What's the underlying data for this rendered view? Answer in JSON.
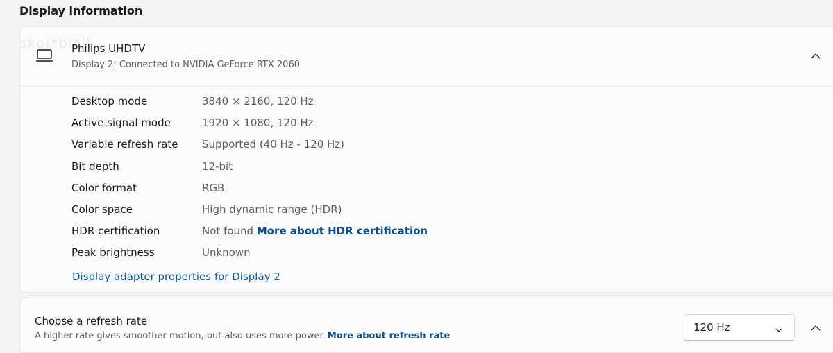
{
  "section": {
    "title": "Display information"
  },
  "display_card": {
    "name": "Philips UHDTV",
    "subtitle": "Display 2: Connected to NVIDIA GeForce RTX 2060",
    "rows": [
      {
        "label": "Desktop mode",
        "value": "3840 × 2160, 120 Hz"
      },
      {
        "label": "Active signal mode",
        "value": "1920 × 1080, 120 Hz"
      },
      {
        "label": "Variable refresh rate",
        "value": "Supported (40 Hz - 120 Hz)"
      },
      {
        "label": "Bit depth",
        "value": "12-bit"
      },
      {
        "label": "Color format",
        "value": "RGB"
      },
      {
        "label": "Color space",
        "value": "High dynamic range (HDR)"
      },
      {
        "label": "HDR certification",
        "value": "Not found",
        "link": "More about HDR certification"
      },
      {
        "label": "Peak brightness",
        "value": "Unknown"
      }
    ],
    "adapter_link": "Display adapter properties for Display 2"
  },
  "refresh_card": {
    "title": "Choose a refresh rate",
    "description": "A higher rate gives smoother motion, but also uses more power",
    "link": "More about refresh rate",
    "dropdown_value": "120 Hz"
  },
  "watermark": "skel*bl*ll",
  "icons": {
    "monitor": "monitor-icon",
    "chevron_up": "chevron-up-icon",
    "chevron_down": "chevron-down-icon"
  },
  "colors": {
    "background": "#f3f3f3",
    "card": "#fbfbfb",
    "link": "#0b4f8a",
    "secondary_text": "#5f5f5f"
  }
}
